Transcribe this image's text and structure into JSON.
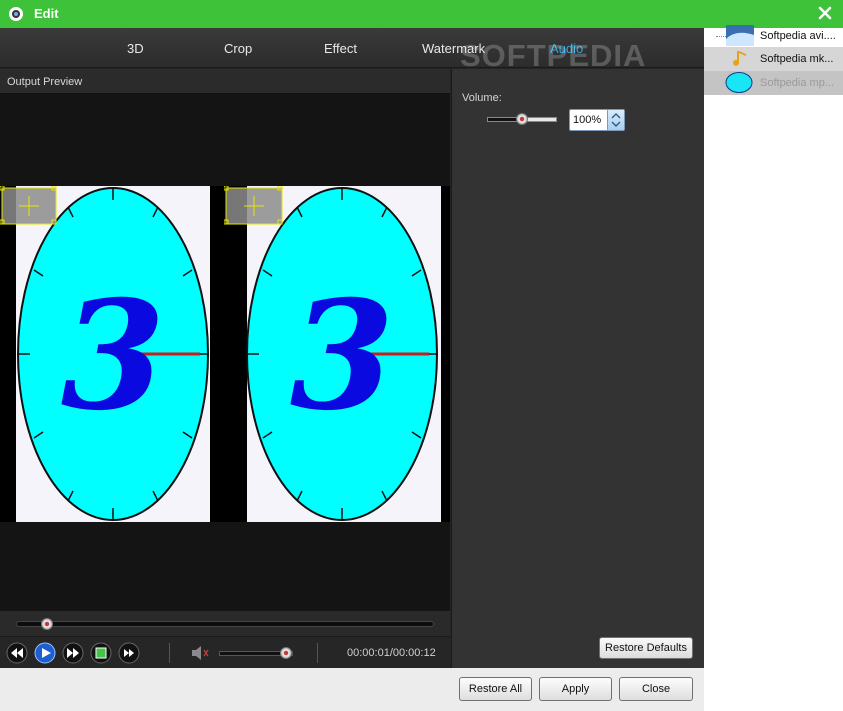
{
  "titlebar": {
    "title": "Edit"
  },
  "tabs": [
    {
      "label": "3D"
    },
    {
      "label": "Crop"
    },
    {
      "label": "Effect"
    },
    {
      "label": "Watermark"
    },
    {
      "label": "Audio",
      "active": true
    }
  ],
  "watermark_overlay": "SOFTPEDIA",
  "preview": {
    "header": "Output Preview",
    "clock_digit": "3",
    "seek_position": 0.083,
    "timecode": "00:00:01/00:00:12",
    "player_volume": 0.9
  },
  "settings": {
    "volume_label": "Volume:",
    "volume_value": "100%",
    "restore_defaults_label": "Restore Defaults"
  },
  "buttons": {
    "restore_all": "Restore All",
    "apply": "Apply",
    "close": "Close"
  },
  "files": [
    {
      "name": "Softpedia avi....",
      "icon": "video-thumbnail-icon",
      "state": "normal"
    },
    {
      "name": "Softpedia mk...",
      "icon": "music-note-icon",
      "state": "selected"
    },
    {
      "name": "Softpedia mp...",
      "icon": "video-thumbnail-icon",
      "state": "disabled"
    }
  ],
  "colors": {
    "titlebar": "#3ec23a",
    "active_tab": "#29a9e6",
    "clock_face": "#00ffff",
    "digit": "#0a0ae0",
    "clock_hand": "#c81e1e"
  }
}
